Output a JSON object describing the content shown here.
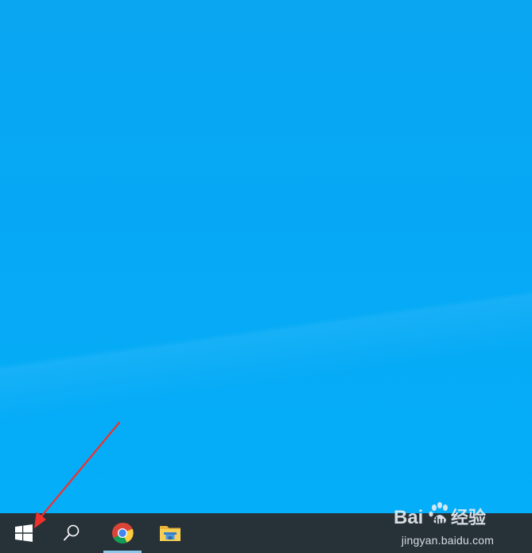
{
  "desktop": {
    "wallpaper_color": "#06a8f5"
  },
  "taskbar": {
    "background_color": "#273238",
    "items": [
      {
        "name": "start",
        "icon": "windows-logo-icon"
      },
      {
        "name": "search",
        "icon": "magnifier-icon"
      },
      {
        "name": "chrome",
        "icon": "chrome-icon",
        "running": true
      },
      {
        "name": "file-explorer",
        "icon": "folder-icon"
      }
    ]
  },
  "annotation": {
    "arrow_color": "#f0312b"
  },
  "watermark": {
    "brand": "Baidu经验",
    "url": "jingyan.baidu.com"
  }
}
